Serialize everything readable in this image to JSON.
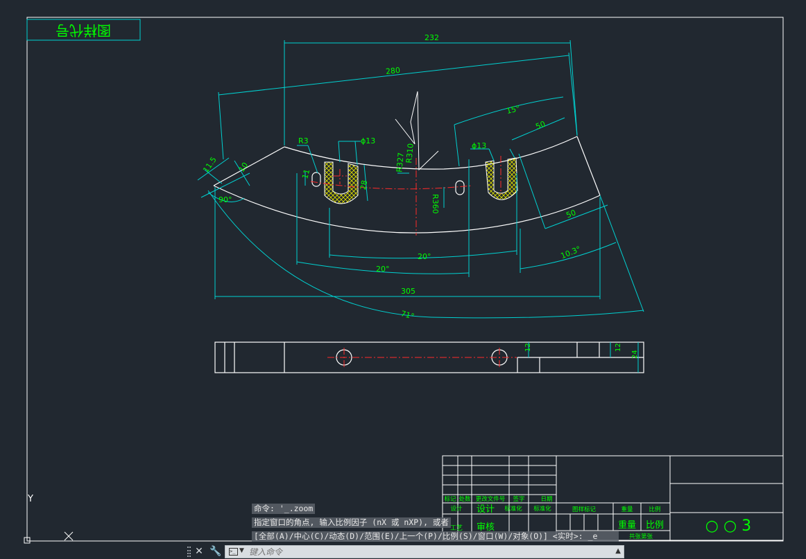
{
  "drawing": {
    "stamp": "图样代号",
    "dimensions": {
      "d232": "232",
      "d280": "280",
      "d305": "305",
      "r3": "R3",
      "phi13_left": "ϕ13",
      "phi13_right": "ϕ13",
      "a15": "15°",
      "d50_top": "50",
      "d50_right": "50",
      "d11_5": "11.5",
      "d10": "10",
      "a90": "90°",
      "d11": "11",
      "d28": "28",
      "r327": "R327",
      "r310": "R310",
      "r360": "R360",
      "a20_inner": "20°",
      "a20_outer": "20°",
      "a10_3": "10.3°",
      "a71": "71°",
      "d12_left": "12",
      "d12_right": "12",
      "d24": "24"
    }
  },
  "title_block": {
    "header_cells": [
      "标记",
      "处数",
      "更改文件号",
      "签字",
      "日期"
    ],
    "row_design": "设计",
    "row_standard1": "标准化",
    "row_standard2": "标准化",
    "row_review": "审核",
    "row_process": "工艺",
    "stage_mark": "图样标记",
    "weight": "重量",
    "scale": "比例",
    "weight_big": "重量",
    "scale_big": "比例",
    "sheets": "共张第张",
    "drawing_no": "○ ○ 3"
  },
  "command_line": {
    "history": [
      "命令: '_.zoom",
      "指定窗口的角点, 输入比例因子 (nX 或 nXP), 或者",
      "[全部(A)/中心(C)/动态(D)/范围(E)/上一个(P)/比例(S)/窗口(W)/对象(O)] <实时>: _e"
    ],
    "placeholder": "键入命令"
  },
  "ucs": {
    "y_label": "Y"
  },
  "colors": {
    "background": "#212830",
    "outline": "#ffffff",
    "dimension": "#00d2d2",
    "dimension_text": "#00ff00",
    "centerline": "#ff2a2a",
    "hatch": "#e6e600"
  }
}
